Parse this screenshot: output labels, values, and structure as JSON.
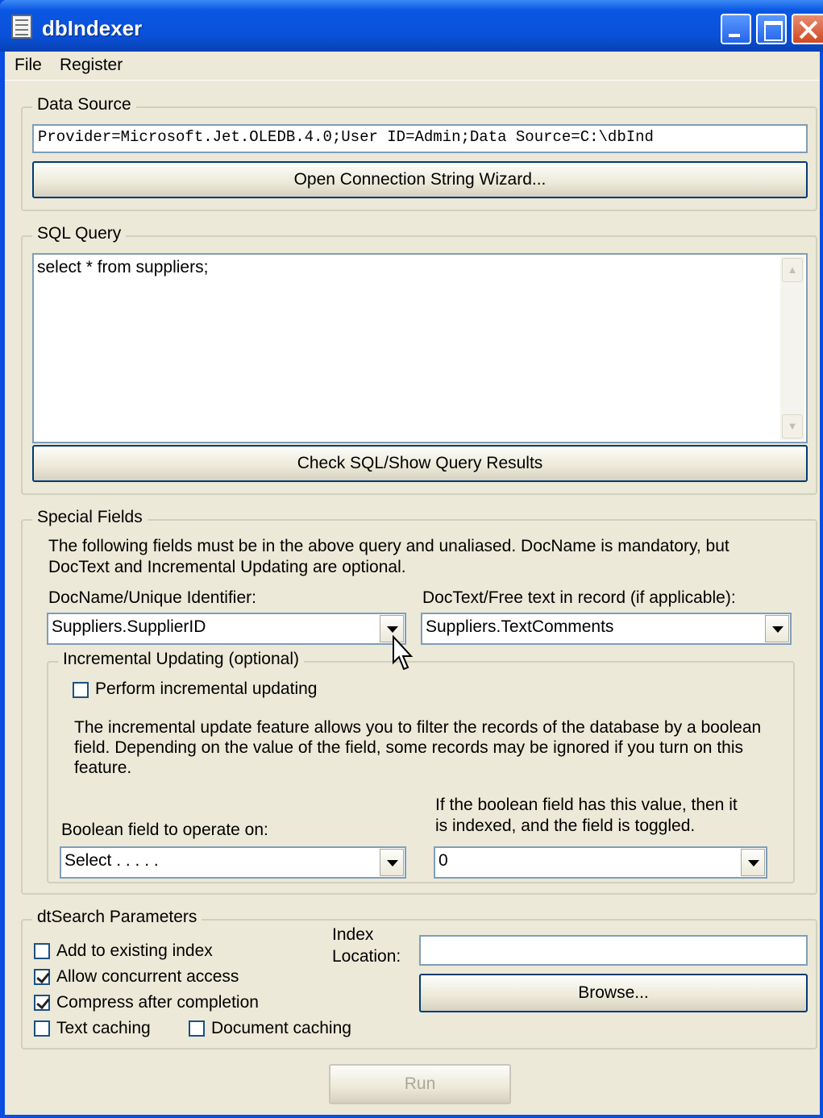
{
  "window": {
    "title": "dbIndexer"
  },
  "menu": {
    "file": "File",
    "register": "Register"
  },
  "data_source": {
    "group_label": "Data Source",
    "connection_string": "Provider=Microsoft.Jet.OLEDB.4.0;User ID=Admin;Data Source=C:\\dbInd",
    "wizard_button": "Open Connection String Wizard..."
  },
  "sql_query": {
    "group_label": "SQL Query",
    "query_text": "select * from suppliers;",
    "check_button": "Check SQL/Show Query Results"
  },
  "special_fields": {
    "group_label": "Special Fields",
    "description": "The following fields must be in the above query and unaliased.  DocName is mandatory, but DocText and Incremental Updating are optional.",
    "docname_label": "DocName/Unique Identifier:",
    "docname_value": "Suppliers.SupplierID",
    "doctext_label": "DocText/Free text in record (if applicable):",
    "doctext_value": "Suppliers.TextComments"
  },
  "incremental": {
    "group_label": "Incremental Updating (optional)",
    "perform_label": "Perform incremental updating",
    "perform_checked": false,
    "description": "The incremental update feature allows you to filter the records of the database by a boolean field.  Depending on the value of the field, some records may be ignored if you turn on this feature.",
    "boolean_label": "Boolean field to operate on:",
    "boolean_value": "Select . . . . .",
    "value_label": "If the boolean field has this value, then it is indexed, and the field is toggled.",
    "value_value": "0"
  },
  "dtsearch": {
    "group_label": "dtSearch Parameters",
    "add_existing": "Add to existing index",
    "allow_concurrent": "Allow concurrent access",
    "compress": "Compress after completion",
    "text_caching": "Text caching",
    "document_caching": "Document caching",
    "index_location_label": "Index Location:",
    "index_location_value": "",
    "browse_button": "Browse..."
  },
  "run_button": "Run"
}
